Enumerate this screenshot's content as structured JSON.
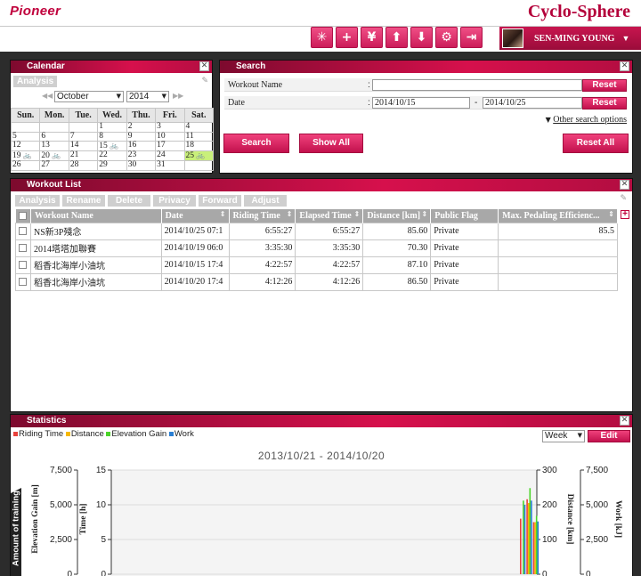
{
  "header": {
    "brand_left": "Pioneer",
    "brand_right": "Cyclo-Sphere",
    "user_name": "SEN-MING YOUNG",
    "nav_icons": [
      "bike-icon",
      "plus-icon",
      "yen-icon",
      "upload-icon",
      "download-icon",
      "gear-icon",
      "logout-icon"
    ]
  },
  "calendar": {
    "title": "Calendar",
    "analysis_label": "Analysis",
    "month": "October",
    "year": "2014",
    "weekdays": [
      "Sun.",
      "Mon.",
      "Tue.",
      "Wed.",
      "Thu.",
      "Fri.",
      "Sat."
    ]
  },
  "search": {
    "title": "Search",
    "workout_name_label": "Workout Name",
    "date_label": "Date",
    "date_from": "2014/10/15",
    "date_to": "2014/10/25",
    "reset_label": "Reset",
    "other_options": "Other search options",
    "search_label": "Search",
    "show_all_label": "Show All",
    "reset_all_label": "Reset All",
    "colon": ":",
    "dash": "-"
  },
  "workout_list": {
    "title": "Workout List",
    "tools": [
      "Analysis",
      "Rename",
      "Delete",
      "Privacy",
      "Forward",
      "Adjust"
    ],
    "columns": [
      "Workout Name",
      "Date",
      "Riding Time",
      "Elapsed Time",
      "Distance [km]",
      "Public Flag",
      "Max. Pedaling Efficienc..."
    ],
    "rows": [
      {
        "name": "NS新3P殘念",
        "date": "2014/10/25 07:1",
        "riding": "6:55:27",
        "elapsed": "6:55:27",
        "distance": "85.60",
        "flag": "Private",
        "eff": "85.5"
      },
      {
        "name": "2014塔塔加聯賽",
        "date": "2014/10/19 06:0",
        "riding": "3:35:30",
        "elapsed": "3:35:30",
        "distance": "70.30",
        "flag": "Private",
        "eff": ""
      },
      {
        "name": "稻香北海岸小油坑",
        "date": "2014/10/15 17:4",
        "riding": "4:22:57",
        "elapsed": "4:22:57",
        "distance": "87.10",
        "flag": "Private",
        "eff": ""
      },
      {
        "name": "稻香北海岸小油坑",
        "date": "2014/10/20 17:4",
        "riding": "4:12:26",
        "elapsed": "4:12:26",
        "distance": "86.50",
        "flag": "Private",
        "eff": ""
      }
    ]
  },
  "statistics": {
    "title": "Statistics",
    "period": "Week",
    "edit_label": "Edit",
    "side_tab": "Amount of training",
    "legend": [
      {
        "name": "Riding Time",
        "color": "#e8413b"
      },
      {
        "name": "Distance",
        "color": "#f5b800"
      },
      {
        "name": "Elevation Gain",
        "color": "#4cd42a"
      },
      {
        "name": "Work",
        "color": "#2a7fd4"
      }
    ]
  },
  "chart_data": {
    "type": "bar",
    "title": "2013/10/21 - 2014/10/20",
    "axes": {
      "elevation": {
        "label": "Elevation Gain [m]",
        "ticks": [
          "7,500",
          "5,000",
          "2,500",
          "0"
        ],
        "max": 7500
      },
      "time": {
        "label": "Time [h]",
        "ticks": [
          "15",
          "10",
          "5",
          "0"
        ],
        "max": 15
      },
      "distance": {
        "label": "Distance [km]",
        "ticks": [
          "300",
          "200",
          "100",
          "0"
        ],
        "max": 300
      },
      "work": {
        "label": "Work [kJ]",
        "ticks": [
          "7,500",
          "5,000",
          "2,500",
          "0"
        ],
        "max": 7500
      }
    },
    "last_weeks": [
      {
        "riding_time_h": 8,
        "distance_km": 0,
        "elevation_m": 5300,
        "work_kJ": 5000
      },
      {
        "riding_time_h": 10.8,
        "distance_km": 205,
        "elevation_m": 6200,
        "work_kJ": 5300
      },
      {
        "riding_time_h": 7.5,
        "distance_km": 150,
        "elevation_m": 4200,
        "work_kJ": 3800
      }
    ]
  }
}
